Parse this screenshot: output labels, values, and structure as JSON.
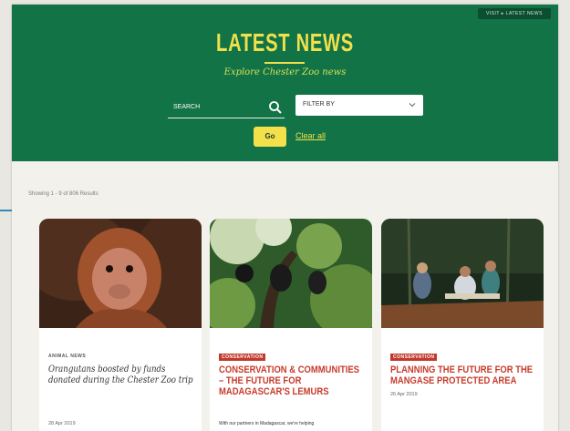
{
  "header": {
    "top_button": "VISIT ▸ LATEST NEWS",
    "title": "LATEST NEWS",
    "subtitle": "Explore Chester Zoo news"
  },
  "search": {
    "placeholder": "SEARCH"
  },
  "filter": {
    "selected": "FILTER BY"
  },
  "actions": {
    "go_label": "Go",
    "clear_label": "Clear all"
  },
  "results": {
    "showing": "Showing 1 - 9 of 806 Results"
  },
  "cards": [
    {
      "category": "ANIMAL NEWS",
      "title": "Orangutans boosted by funds donated during the Chester Zoo trip",
      "date": "28 Apr 2019"
    },
    {
      "category": "CONSERVATION",
      "title": "CONSERVATION & COMMUNITIES – THE FUTURE FOR MADAGASCAR'S LEMURS",
      "description": "With our partners in Madagascar, we're helping"
    },
    {
      "category": "CONSERVATION",
      "title": "PLANNING THE FUTURE FOR THE MANGASE PROTECTED AREA",
      "date": "26 Apr 2019"
    }
  ],
  "colors": {
    "hero": "#127346",
    "accent_yellow": "#f3e04a",
    "category_red": "#c0392b"
  }
}
